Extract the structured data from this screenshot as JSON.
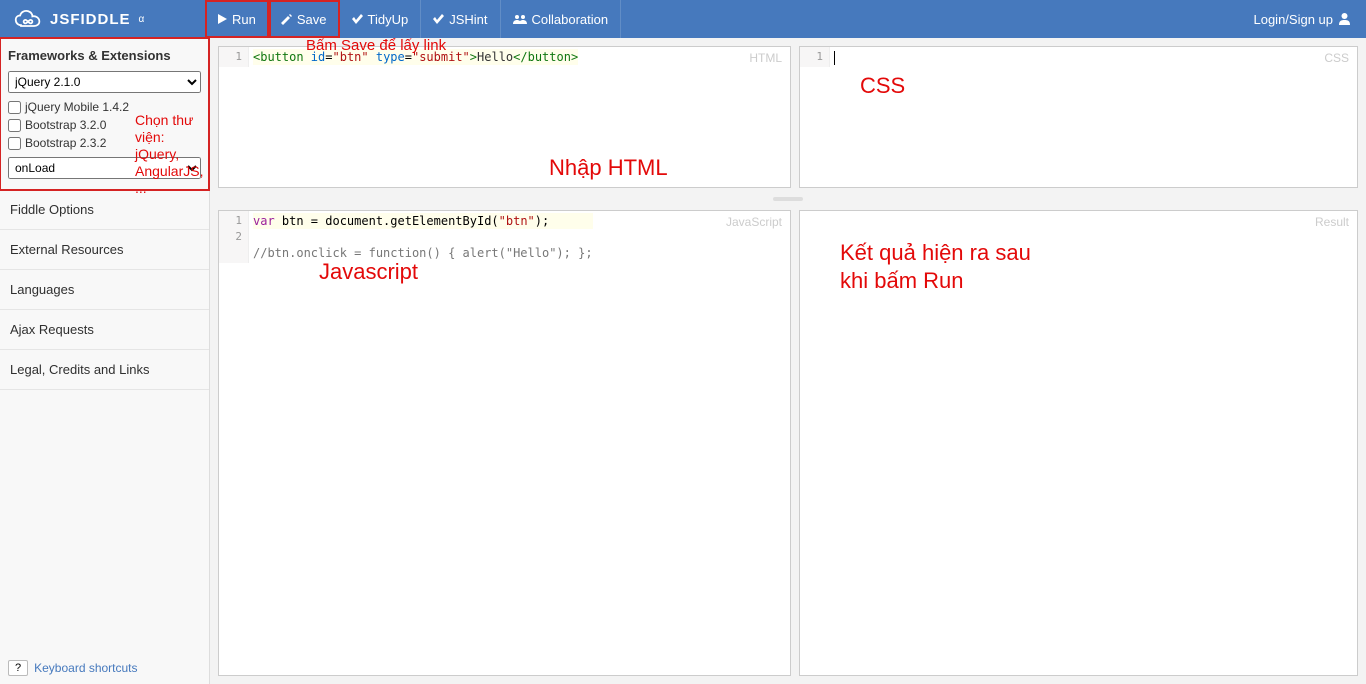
{
  "brand": {
    "name": "JSFIDDLE",
    "alpha": "α"
  },
  "toolbar": {
    "run_label": "Run",
    "save_label": "Save",
    "tidy_label": "TidyUp",
    "jshint_label": "JSHint",
    "collab_label": "Collaboration"
  },
  "login_label": "Login/Sign up",
  "sidebar": {
    "frameworks_title": "Frameworks & Extensions",
    "framework_selected": "jQuery 2.1.0",
    "libs": [
      "jQuery Mobile 1.4.2",
      "Bootstrap 3.2.0",
      "Bootstrap 2.3.2"
    ],
    "wrap_selected": "onLoad",
    "links": [
      "Fiddle Options",
      "External Resources",
      "Languages",
      "Ajax Requests",
      "Legal, Credits and Links"
    ],
    "kbd_hint": "?",
    "kbd_label": "Keyboard shortcuts"
  },
  "panes": {
    "html_label": "HTML",
    "css_label": "CSS",
    "js_label": "JavaScript",
    "result_label": "Result",
    "html_code": {
      "parts": [
        "<button",
        " id",
        "=",
        "\"btn\"",
        " type",
        "=",
        "\"submit\"",
        ">",
        "Hello",
        "</button>"
      ]
    },
    "js_code": {
      "line1": {
        "kw": "var",
        "rest": " btn = document.getElementById(",
        "str": "\"btn\"",
        "end": ");"
      },
      "line2": "//btn.onclick = function() { alert(\"Hello\"); };"
    }
  },
  "annotations": {
    "save_note": "Bấm Save để lấy link",
    "lib_note_l1": "Chọn thư viện: jQuery,",
    "lib_note_l2": "AngularJS, ...",
    "html_note": "Nhập HTML",
    "css_note": "CSS",
    "js_note": "Javascript",
    "result_note_l1": "Kết quả hiện ra sau",
    "result_note_l2": "khi bấm Run"
  }
}
